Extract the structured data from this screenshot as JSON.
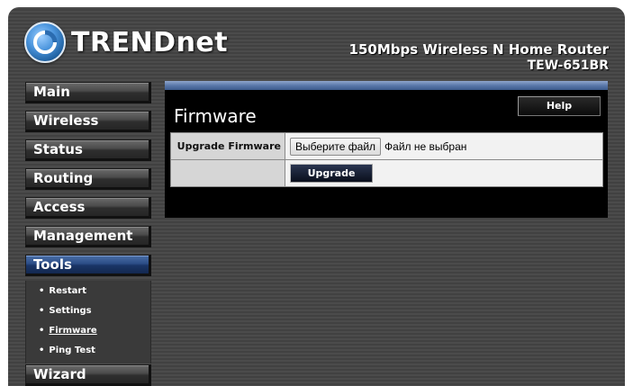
{
  "header": {
    "brand": "TRENDnet",
    "product_name": "150Mbps Wireless N Home Router",
    "model": "TEW-651BR"
  },
  "sidebar": {
    "items": [
      {
        "label": "Main"
      },
      {
        "label": "Wireless"
      },
      {
        "label": "Status"
      },
      {
        "label": "Routing"
      },
      {
        "label": "Access"
      },
      {
        "label": "Management"
      },
      {
        "label": "Tools"
      },
      {
        "label": "Wizard"
      }
    ],
    "active": "Tools",
    "submenu": [
      {
        "label": "Restart"
      },
      {
        "label": "Settings"
      },
      {
        "label": "Firmware"
      },
      {
        "label": "Ping Test"
      }
    ],
    "submenu_current": "Firmware"
  },
  "content": {
    "title": "Firmware",
    "help_label": "Help",
    "upgrade_firmware_label": "Upgrade Firmware",
    "file_button_label": "Выберите файл",
    "file_status": "Файл не выбран",
    "upgrade_button_label": "Upgrade"
  },
  "colors": {
    "active_menu": "#2c4d86",
    "panel_bar": "#5a78aa",
    "background_stripe": "#4b4b4b"
  }
}
